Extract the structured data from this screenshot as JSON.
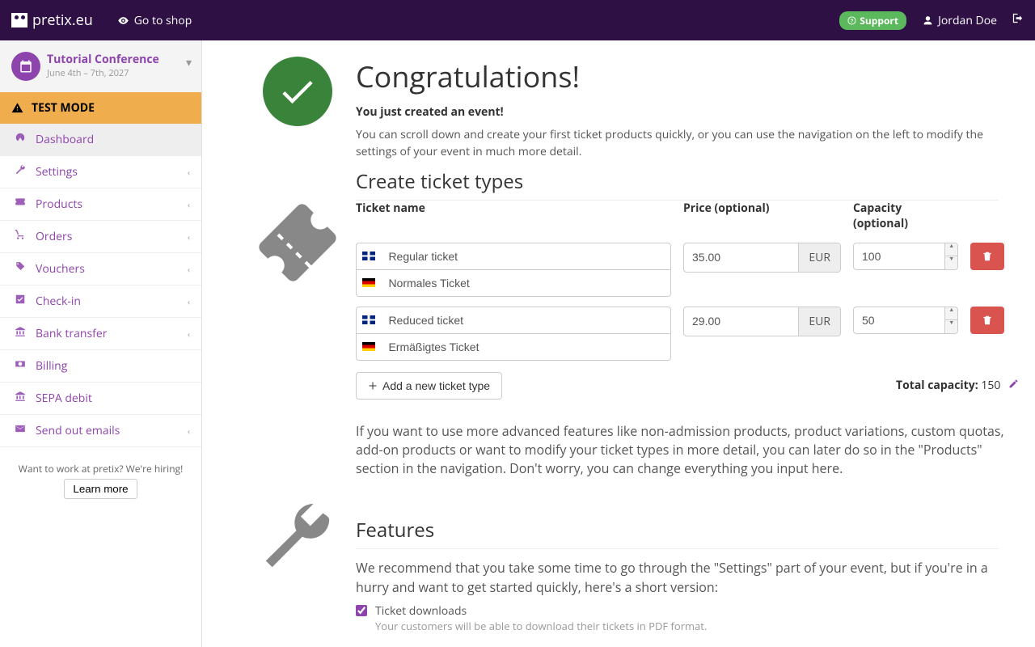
{
  "brand": "pretix.eu",
  "shop_link": "Go to shop",
  "support_label": "Support",
  "user_name": "Jordan Doe",
  "event": {
    "name": "Tutorial Conference",
    "dates": "June 4th – 7th, 2027"
  },
  "testmode": "TEST MODE",
  "nav": {
    "dashboard": "Dashboard",
    "settings": "Settings",
    "products": "Products",
    "orders": "Orders",
    "vouchers": "Vouchers",
    "checkin": "Check-in",
    "banktransfer": "Bank transfer",
    "billing": "Billing",
    "sepa": "SEPA debit",
    "emails": "Send out emails"
  },
  "hiring": {
    "text": "Want to work at pretix? We're hiring!",
    "button": "Learn more"
  },
  "congrats": {
    "title": "Congratulations!",
    "sub": "You just created an event!",
    "body": "You can scroll down and create your first ticket products quickly, or you can use the navigation on the left to modify the settings of your event in much more detail."
  },
  "tickets": {
    "heading": "Create ticket types",
    "col_name": "Ticket name",
    "col_price": "Price (optional)",
    "col_cap": "Capacity (optional)",
    "currency": "EUR",
    "rows": [
      {
        "name_en": "Regular ticket",
        "name_de": "Normales Ticket",
        "price": "35.00",
        "cap": "100"
      },
      {
        "name_en": "Reduced ticket",
        "name_de": "Ermäßigtes Ticket",
        "price": "29.00",
        "cap": "50"
      }
    ],
    "add_label": "Add a new ticket type",
    "total_label": "Total capacity:",
    "total_value": "150",
    "footer": "If you want to use more advanced features like non-admission products, product variations, custom quotas, add-on products or want to modify your ticket types in more detail, you can later do so in the \"Products\" section in the navigation. Don't worry, you can change everything you input here."
  },
  "features": {
    "heading": "Features",
    "intro": "We recommend that you take some time to go through the \"Settings\" part of your event, but if you're in a hurry and want to get started quickly, here's a short version:",
    "ticket_dl": {
      "label": "Ticket downloads",
      "checked": true,
      "hint": "Your customers will be able to download their tickets in PDF format."
    }
  }
}
